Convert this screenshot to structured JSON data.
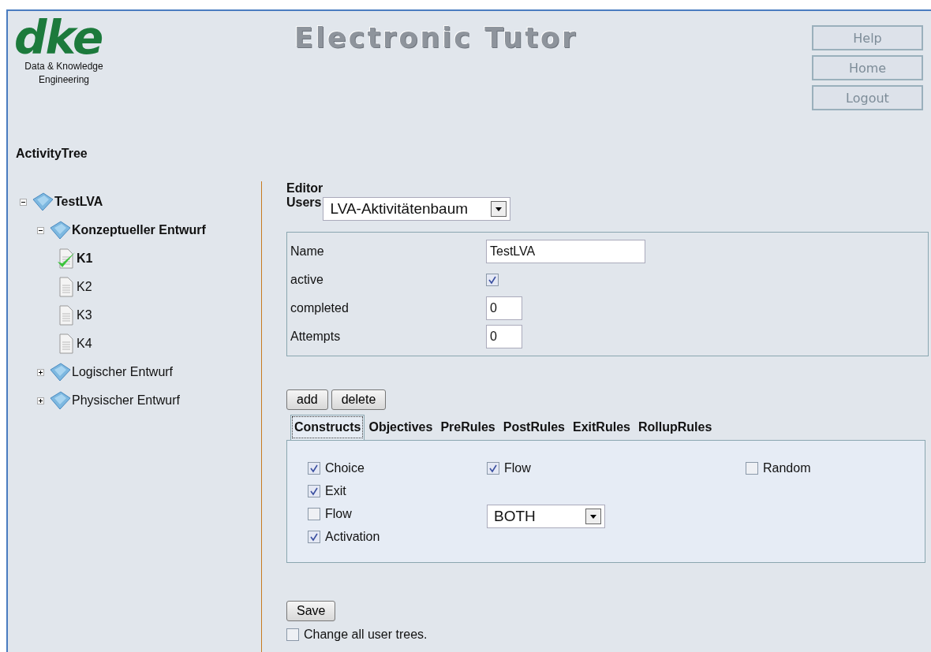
{
  "logo": {
    "mark": "dke",
    "caption_lines": [
      "Data & Knowledge",
      "Engineering"
    ]
  },
  "app_title": "Electronic Tutor",
  "nav_buttons": [
    "Help",
    "Home",
    "Logout"
  ],
  "tree": {
    "title": "ActivityTree",
    "nodes": [
      {
        "label": "TestLVA",
        "kind": "folder",
        "expanded": true,
        "children": [
          {
            "label": "Konzeptueller Entwurf",
            "kind": "folder",
            "expanded": true,
            "children": [
              {
                "label": "K1",
                "kind": "page",
                "selected": true,
                "completed": true
              },
              {
                "label": "K2",
                "kind": "page",
                "selected": false,
                "completed": false
              },
              {
                "label": "K3",
                "kind": "page",
                "selected": false,
                "completed": false
              },
              {
                "label": "K4",
                "kind": "page",
                "selected": false,
                "completed": false
              }
            ]
          },
          {
            "label": "Logischer Entwurf",
            "kind": "folder",
            "expanded": false
          },
          {
            "label": "Physischer Entwurf",
            "kind": "folder",
            "expanded": false
          }
        ]
      }
    ]
  },
  "editor": {
    "heading": "Editor",
    "users_label": "Users",
    "users_value": "LVA-Aktivitätenbaum",
    "fields": [
      {
        "label": "Name",
        "kind": "text",
        "value": "TestLVA"
      },
      {
        "label": "active",
        "kind": "checkbox",
        "checked": true
      },
      {
        "label": "completed",
        "kind": "number",
        "value": "0"
      },
      {
        "label": "Attempts",
        "kind": "number",
        "value": "0"
      }
    ],
    "actions": [
      "add",
      "delete"
    ],
    "tabs": [
      {
        "label": "Constructs",
        "selected": true
      },
      {
        "label": "Objectives",
        "selected": false
      },
      {
        "label": "PreRules",
        "selected": false
      },
      {
        "label": "PostRules",
        "selected": false
      },
      {
        "label": "ExitRules",
        "selected": false
      },
      {
        "label": "RollupRules",
        "selected": false
      }
    ],
    "constructs": {
      "left": [
        {
          "label": "Choice",
          "checked": true
        },
        {
          "label": "Exit",
          "checked": true
        },
        {
          "label": "Flow",
          "checked": false
        },
        {
          "label": "Activation",
          "checked": true
        }
      ],
      "middle": {
        "checkbox": {
          "label": "Flow",
          "checked": true
        },
        "select_value": "BOTH"
      },
      "right": [
        {
          "label": "Random",
          "checked": false
        }
      ]
    },
    "save": "Save",
    "change_all": {
      "label": "Change all user trees.",
      "checked": false
    }
  }
}
